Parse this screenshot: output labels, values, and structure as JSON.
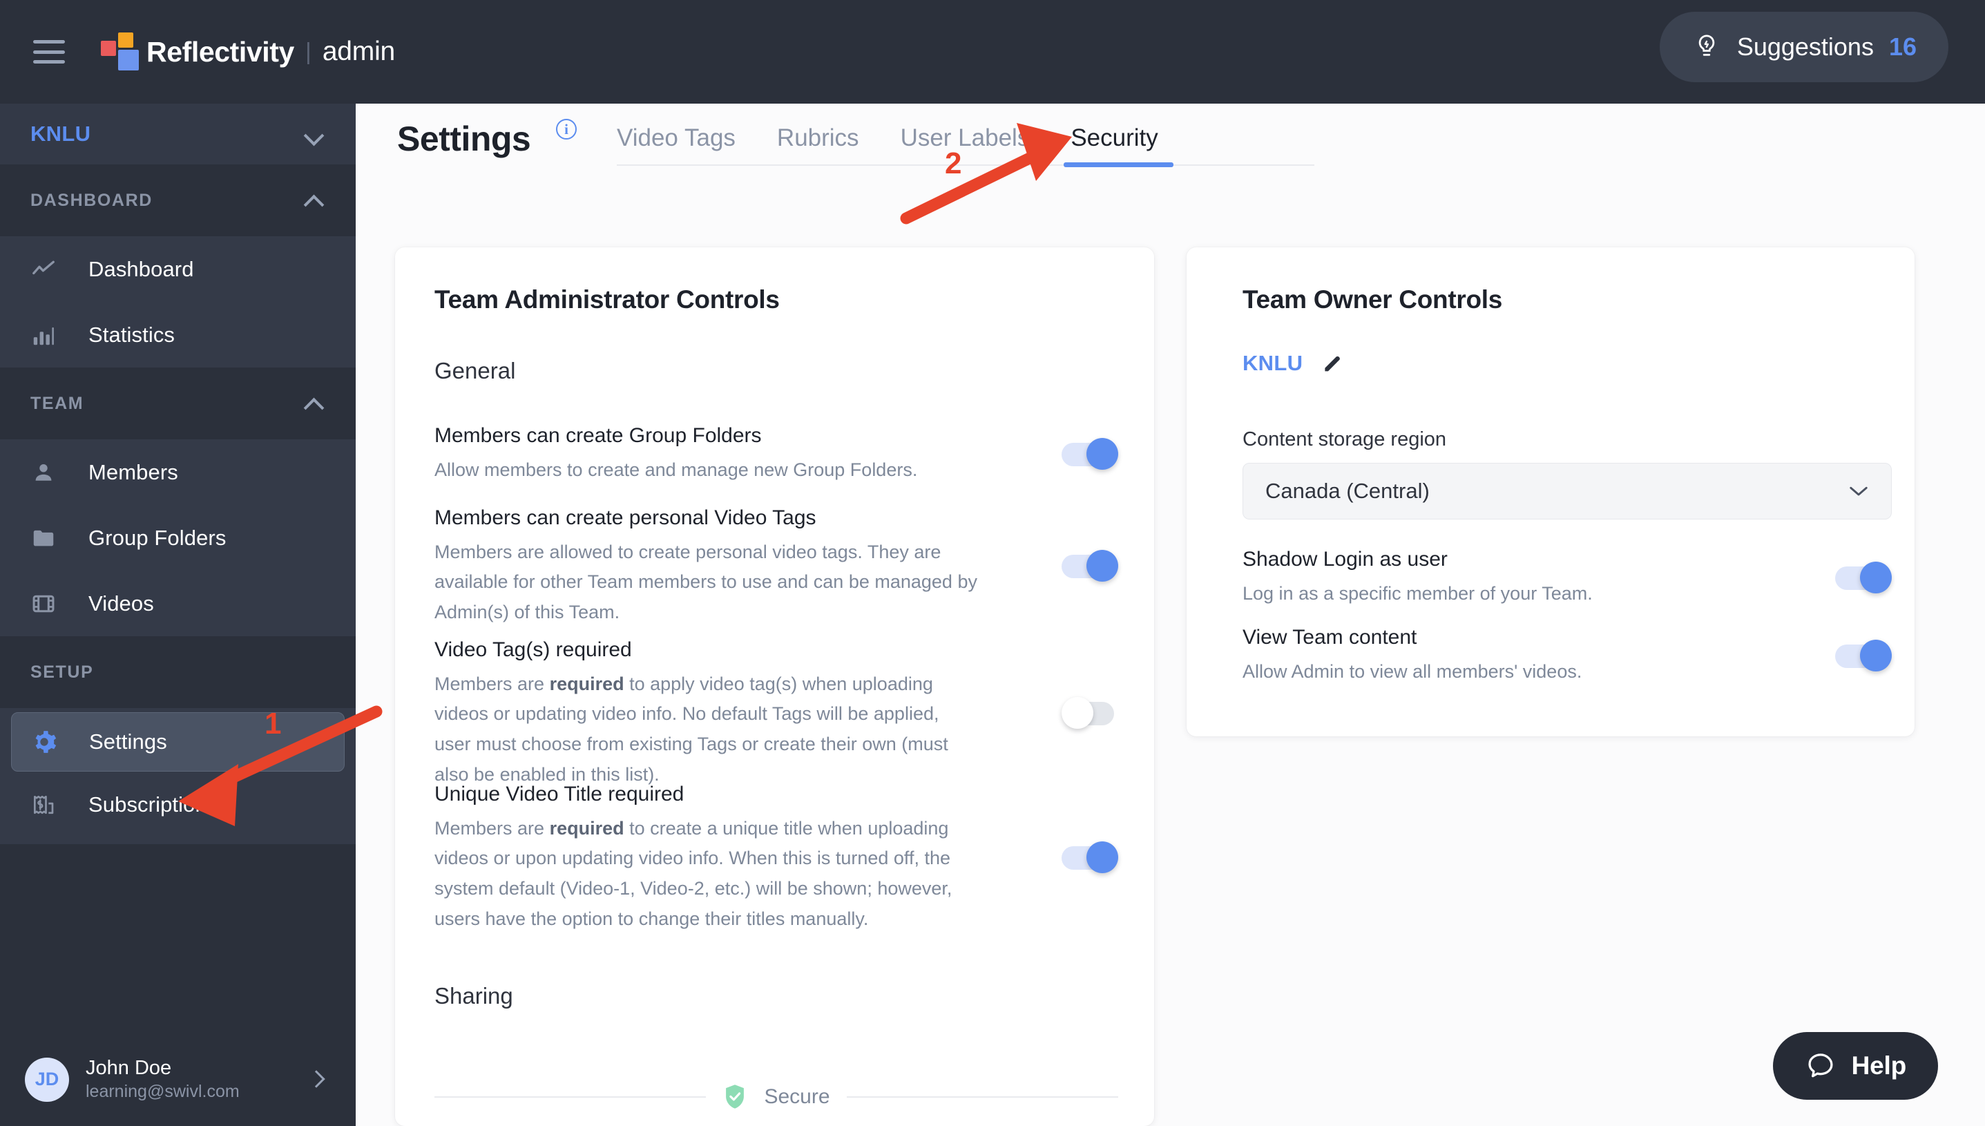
{
  "topbar": {
    "menu_icon": "hamburger-icon",
    "brand": "Reflectivity",
    "separator": "|",
    "brand_sub": "admin",
    "suggestions": {
      "icon": "lightbulb-icon",
      "label": "Suggestions",
      "count": "16"
    }
  },
  "sidebar": {
    "team": {
      "name": "KNLU",
      "icon": "chevron-down-icon"
    },
    "groups": [
      {
        "header": "DASHBOARD",
        "header_icon": "chevron-up-icon",
        "items": [
          {
            "label": "Dashboard",
            "icon": "line-chart-icon",
            "active": false
          },
          {
            "label": "Statistics",
            "icon": "bar-chart-icon",
            "active": false
          }
        ]
      },
      {
        "header": "TEAM",
        "header_icon": "chevron-up-icon",
        "items": [
          {
            "label": "Members",
            "icon": "person-icon",
            "active": false
          },
          {
            "label": "Group Folders",
            "icon": "folder-icon",
            "active": false
          },
          {
            "label": "Videos",
            "icon": "film-icon",
            "active": false
          }
        ]
      },
      {
        "header": "SETUP",
        "header_icon": "",
        "items": [
          {
            "label": "Settings",
            "icon": "gear-icon",
            "active": true
          },
          {
            "label": "Subscriptions",
            "icon": "receipt-dollar-icon",
            "active": false
          }
        ]
      }
    ],
    "profile": {
      "initials": "JD",
      "name": "John Doe",
      "email": "learning@swivl.com",
      "chevron": "chevron-right-icon"
    }
  },
  "page": {
    "title": "Settings",
    "info_icon": "info-icon",
    "info_glyph": "i",
    "tabs": [
      {
        "label": "Video Tags",
        "active": false
      },
      {
        "label": "Rubrics",
        "active": false
      },
      {
        "label": "User Labels",
        "active": false
      },
      {
        "label": "Security",
        "active": true
      }
    ]
  },
  "admin_card": {
    "title": "Team Administrator Controls",
    "sections": [
      {
        "label": "General",
        "settings": [
          {
            "name": "Members can create Group Folders",
            "desc_parts": [
              {
                "t": "Allow members to create and manage new Group Folders.",
                "b": false
              }
            ],
            "toggle": "on"
          },
          {
            "name": "Members can create personal Video Tags",
            "desc_parts": [
              {
                "t": "Members are allowed to create personal video tags. They are available for other Team members to use and can be managed by Admin(s) of this Team.",
                "b": false
              }
            ],
            "toggle": "on"
          },
          {
            "name": "Video Tag(s) required",
            "desc_parts": [
              {
                "t": "Members are ",
                "b": false
              },
              {
                "t": "required",
                "b": true
              },
              {
                "t": " to apply video tag(s) when uploading videos or updating video info. No default Tags will be applied, user must choose from existing Tags or create their own (must also be enabled in this list).",
                "b": false
              }
            ],
            "toggle": "off"
          },
          {
            "name": "Unique Video Title required",
            "desc_parts": [
              {
                "t": "Members are ",
                "b": false
              },
              {
                "t": "required",
                "b": true
              },
              {
                "t": " to create a unique title when uploading videos or upon updating video info. When this is turned off, the system default (Video-1, Video-2, etc.) will be shown; however, users have the option to change their titles manually.",
                "b": false
              }
            ],
            "toggle": "on"
          }
        ]
      },
      {
        "label": "Sharing",
        "settings": []
      }
    ],
    "secure": {
      "icon": "shield-check-icon",
      "label": "Secure"
    }
  },
  "owner_card": {
    "title": "Team Owner Controls",
    "team_name": "KNLU",
    "edit_icon": "pencil-icon",
    "storage": {
      "label": "Content storage region",
      "value": "Canada (Central)",
      "chevron": "chevron-down-icon"
    },
    "settings": [
      {
        "name": "Shadow Login as user",
        "desc": "Log in as a specific member of your Team.",
        "toggle": "on"
      },
      {
        "name": "View Team content",
        "desc": "Allow Admin to view all members' videos.",
        "toggle": "on"
      }
    ]
  },
  "help": {
    "icon": "chat-bubble-icon",
    "label": "Help"
  },
  "annotations": [
    {
      "number": "1",
      "target": "sidebar-item-settings"
    },
    {
      "number": "2",
      "target": "tab-security"
    }
  ],
  "colors": {
    "accent_blue": "#5c8def",
    "sidebar_bg": "#2b303b",
    "annotation_red": "#e8432a",
    "logo_red": "#ea5b5b",
    "logo_orange": "#f5a524",
    "logo_blue": "#6d95ef"
  }
}
